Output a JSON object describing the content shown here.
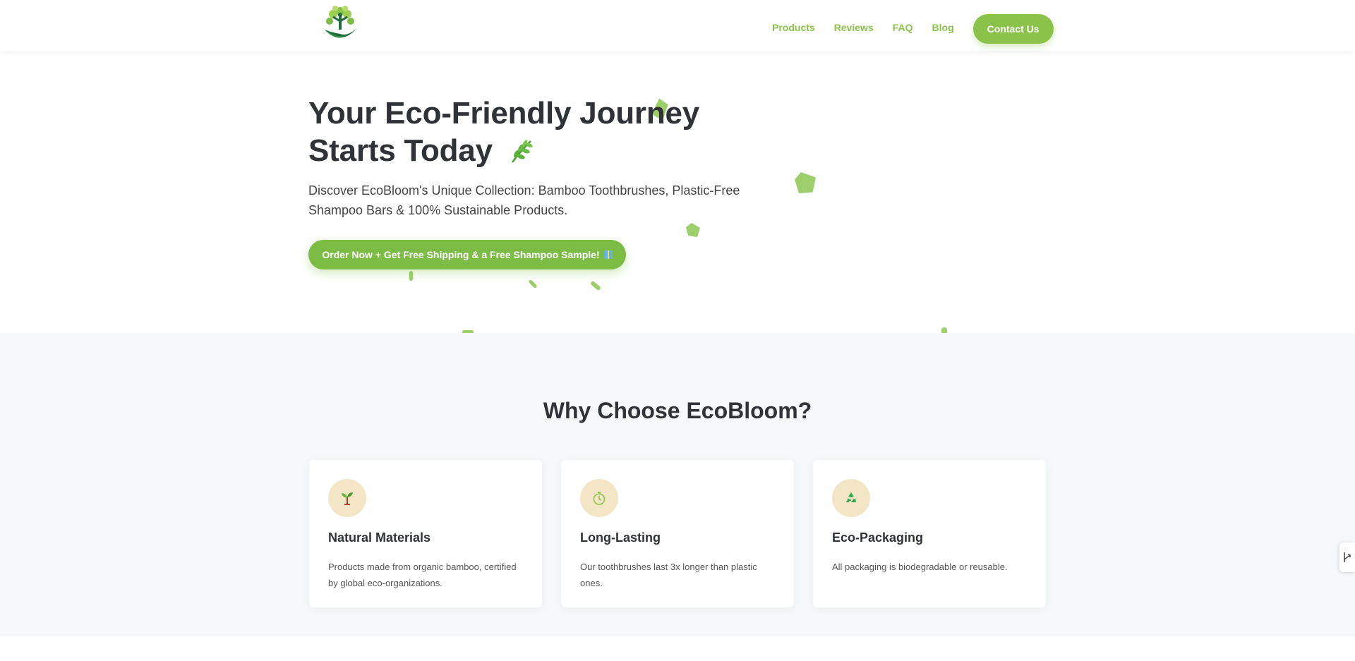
{
  "header": {
    "nav": [
      {
        "label": "Products"
      },
      {
        "label": "Reviews"
      },
      {
        "label": "FAQ"
      },
      {
        "label": "Blog"
      }
    ],
    "contact_label": "Contact Us"
  },
  "hero": {
    "title_line1": "Your Eco-Friendly Journey",
    "title_line2": "Starts Today",
    "subtitle": "Discover EcoBloom's Unique Collection: Bamboo Toothbrushes, Plastic-Free Shampoo Bars & 100% Sustainable Products.",
    "cta_label": "Order Now + Get Free Shipping & a Free Shampoo Sample!"
  },
  "features": {
    "title": "Why Choose EcoBloom?",
    "cards": [
      {
        "icon": "seedling-icon",
        "title": "Natural Materials",
        "text": "Products made from organic bamboo, certified by global eco-organizations."
      },
      {
        "icon": "stopwatch-icon",
        "title": "Long-Lasting",
        "text": "Our toothbrushes last 3x longer than plastic ones."
      },
      {
        "icon": "recycle-icon",
        "title": "Eco-Packaging",
        "text": "All packaging is biodegradable or reusable."
      }
    ]
  },
  "colors": {
    "brand_green": "#8bc34a",
    "cta_green": "#7cbc44",
    "text_dark": "#2f3337",
    "section_bg": "#f6f8f9",
    "icon_bg": "#f3e6c6"
  }
}
